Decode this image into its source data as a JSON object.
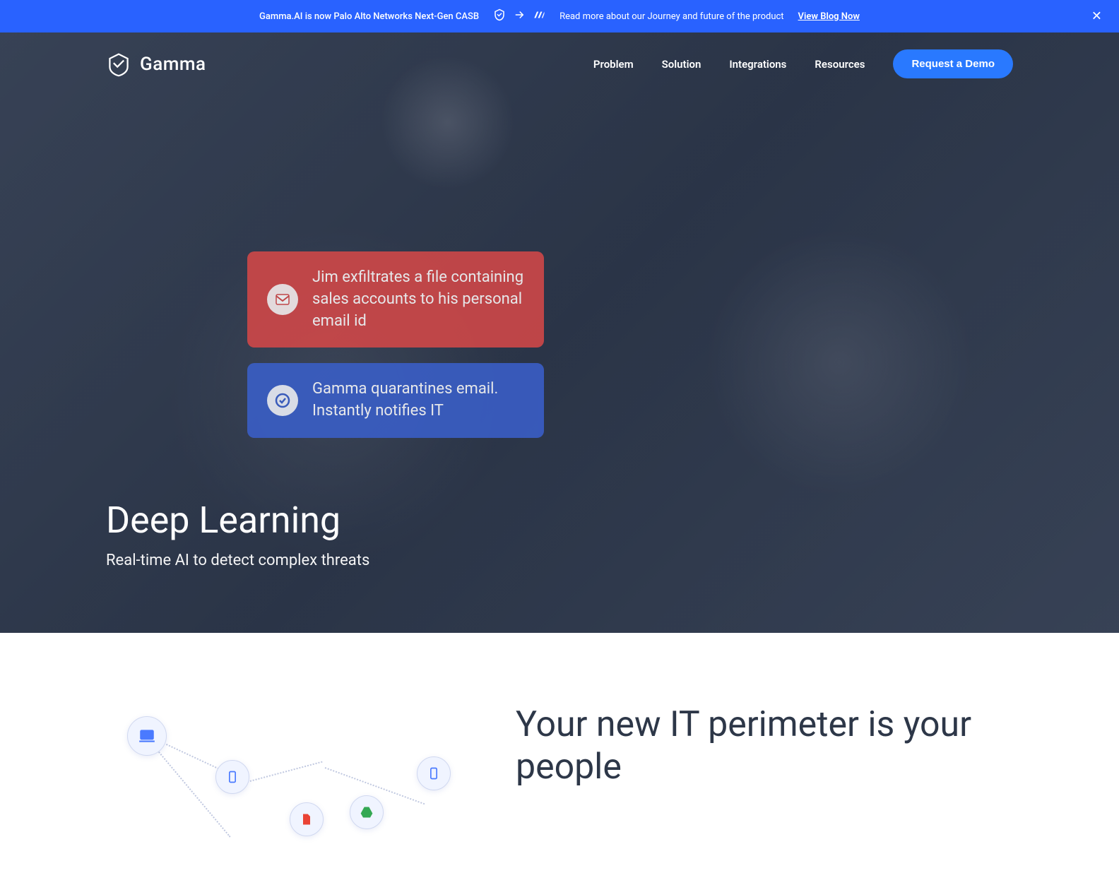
{
  "announcement": {
    "primary_text": "Gamma.AI is now Palo Alto Networks Next-Gen CASB",
    "secondary_text": "Read more about our Journey and future of the product",
    "link_text": "View Blog Now"
  },
  "brand": {
    "name": "Gamma"
  },
  "nav": {
    "items": [
      {
        "label": "Problem"
      },
      {
        "label": "Solution"
      },
      {
        "label": "Integrations"
      },
      {
        "label": "Resources"
      }
    ],
    "cta_label": "Request a Demo"
  },
  "notifications": {
    "alert": {
      "text": "Jim exfiltrates a file containing sales accounts to his personal email id",
      "icon": "gmail"
    },
    "resolution": {
      "text": "Gamma quarantines email. Instantly notifies IT",
      "icon": "check"
    }
  },
  "hero": {
    "title": "Deep Learning",
    "subtitle": "Real-time AI to detect complex threats"
  },
  "section_two": {
    "heading": "Your new IT perimeter is your people"
  },
  "colors": {
    "primary_blue": "#2962ff",
    "cta_blue": "#2979ff",
    "alert_red": "#d34848",
    "notification_blue": "#3a5fc9"
  }
}
